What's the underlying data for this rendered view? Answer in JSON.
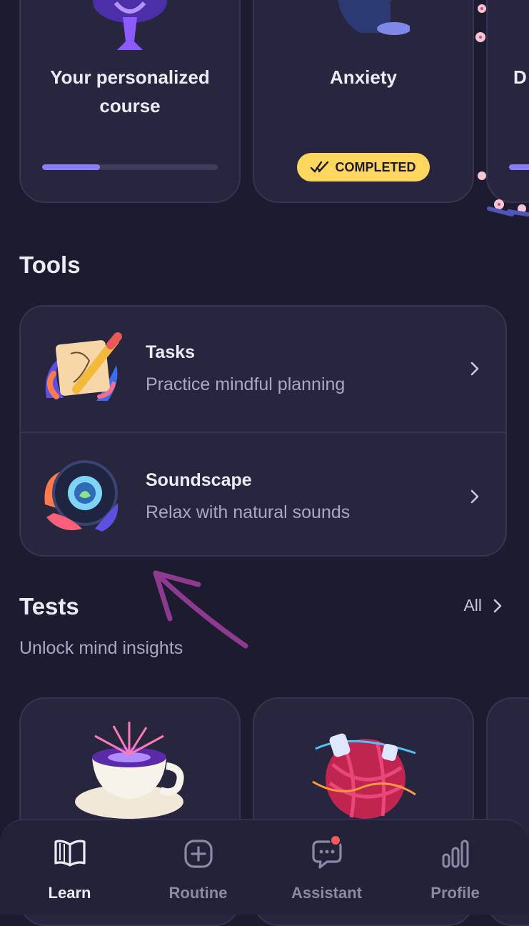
{
  "courses": [
    {
      "title": "Your personalized course",
      "progress": 0.33
    },
    {
      "title": "Anxiety",
      "badge": "COMPLETED"
    },
    {
      "title": "D"
    }
  ],
  "tools": {
    "title": "Tools",
    "items": [
      {
        "title": "Tasks",
        "description": "Practice mindful planning",
        "icon": "tasks-illustration"
      },
      {
        "title": "Soundscape",
        "description": "Relax with natural sounds",
        "icon": "soundscape-illustration"
      }
    ]
  },
  "tests": {
    "title": "Tests",
    "subtitle": "Unlock mind insights",
    "all_label": "All"
  },
  "nav": {
    "items": [
      {
        "label": "Learn",
        "icon": "book-icon",
        "active": true
      },
      {
        "label": "Routine",
        "icon": "plus-square-icon"
      },
      {
        "label": "Assistant",
        "icon": "chat-icon",
        "has_notification": true
      },
      {
        "label": "Profile",
        "icon": "bar-chart-icon"
      }
    ]
  },
  "colors": {
    "background": "#1c1b30",
    "card": "#27263e",
    "accent": "#8a7dff",
    "badge": "#ffd75e",
    "notification": "#ff5a5a",
    "annotation_arrow": "#8e3b8f"
  }
}
